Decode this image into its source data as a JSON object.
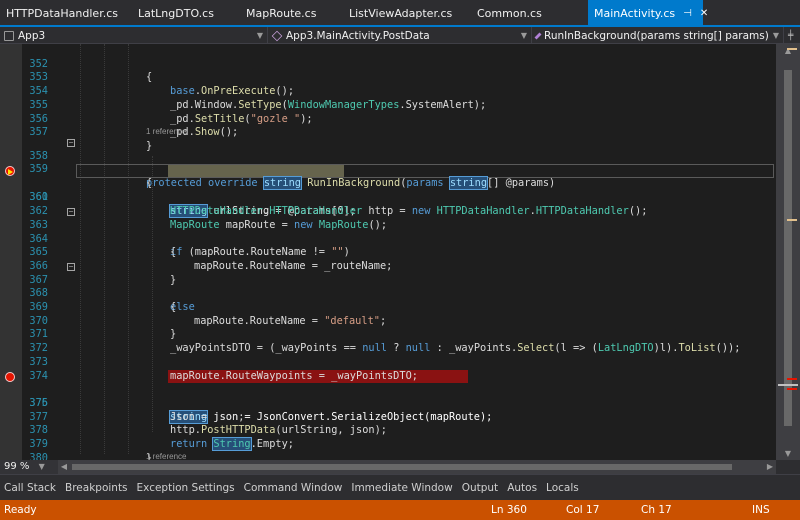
{
  "tabs": [
    {
      "label": "HTTPDataHandler.cs",
      "active": false
    },
    {
      "label": "LatLngDTO.cs",
      "active": false
    },
    {
      "label": "MapRoute.cs",
      "active": false
    },
    {
      "label": "ListViewAdapter.cs",
      "active": false
    },
    {
      "label": "Common.cs",
      "active": false
    },
    {
      "label": "MainActivity.cs",
      "active": true
    }
  ],
  "navbar": {
    "project": "App3",
    "type": "App3.MainActivity.PostData",
    "member": "RunInBackground(params string[] params)"
  },
  "editor": {
    "code_lens": "1 reference",
    "lines": [
      {
        "num": "352",
        "text": "{"
      },
      {
        "num": "353",
        "text": "base.OnPreExecute();"
      },
      {
        "num": "354",
        "text": "_pd.Window.SetType(WindowManagerTypes.SystemAlert);"
      },
      {
        "num": "355",
        "text": "_pd.SetTitle(\"gozle \");"
      },
      {
        "num": "356",
        "text": "_pd.Show();"
      },
      {
        "num": "357",
        "text": "}"
      },
      {
        "num": "358",
        "text": "protected override string RunInBackground(params string[] @params)"
      },
      {
        "num": "359",
        "text": "{"
      },
      {
        "num": "360",
        "text": "string urlString = @params[0];"
      },
      {
        "num": "361",
        "text": "HTTPDataHandler.HTTPDataHandler http = new HTTPDataHandler.HTTPDataHandler();"
      },
      {
        "num": "362",
        "text": "MapRoute mapRoute = new MapRoute();"
      },
      {
        "num": "363",
        "text": "if (mapRoute.RouteName != \"\")"
      },
      {
        "num": "364",
        "text": "{"
      },
      {
        "num": "365",
        "text": "mapRoute.RouteName = _routeName;"
      },
      {
        "num": "366",
        "text": "}"
      },
      {
        "num": "367",
        "text": "else"
      },
      {
        "num": "368",
        "text": "{"
      },
      {
        "num": "369",
        "text": "mapRoute.RouteName = \"default\";"
      },
      {
        "num": "370",
        "text": "}"
      },
      {
        "num": "371",
        "text": "_wayPointsDTO = (_wayPoints == null ? null : _wayPoints.Select(l => (LatLngDTO)l).ToList());"
      },
      {
        "num": "372",
        "text": ""
      },
      {
        "num": "373",
        "text": "mapRoute.RouteWaypoints = _wayPointsDTO;"
      },
      {
        "num": "374",
        "text": ""
      },
      {
        "num": "375",
        "text": "string json = JsonConvert.SerializeObject(mapRoute);"
      },
      {
        "num": "376",
        "text": "Json = json;"
      },
      {
        "num": "377",
        "text": "http.PostHTTPData(urlString, json);"
      },
      {
        "num": "378",
        "text": "return String.Empty;"
      },
      {
        "num": "379",
        "text": "}"
      },
      {
        "num": "380",
        "text": ""
      }
    ]
  },
  "zoom": "99 %",
  "tool_windows": [
    "Call Stack",
    "Breakpoints",
    "Exception Settings",
    "Command Window",
    "Immediate Window",
    "Output",
    "Autos",
    "Locals"
  ],
  "status": {
    "state": "Ready",
    "line": "Ln 360",
    "col": "Col 17",
    "ch": "Ch 17",
    "mode": "INS"
  },
  "colors": {
    "status_bar": "#ca5100",
    "active_tab": "#007acc",
    "keyword": "#569cd6",
    "type": "#4ec9b0",
    "string": "#d69d85",
    "breakpoint": "#e51400"
  }
}
